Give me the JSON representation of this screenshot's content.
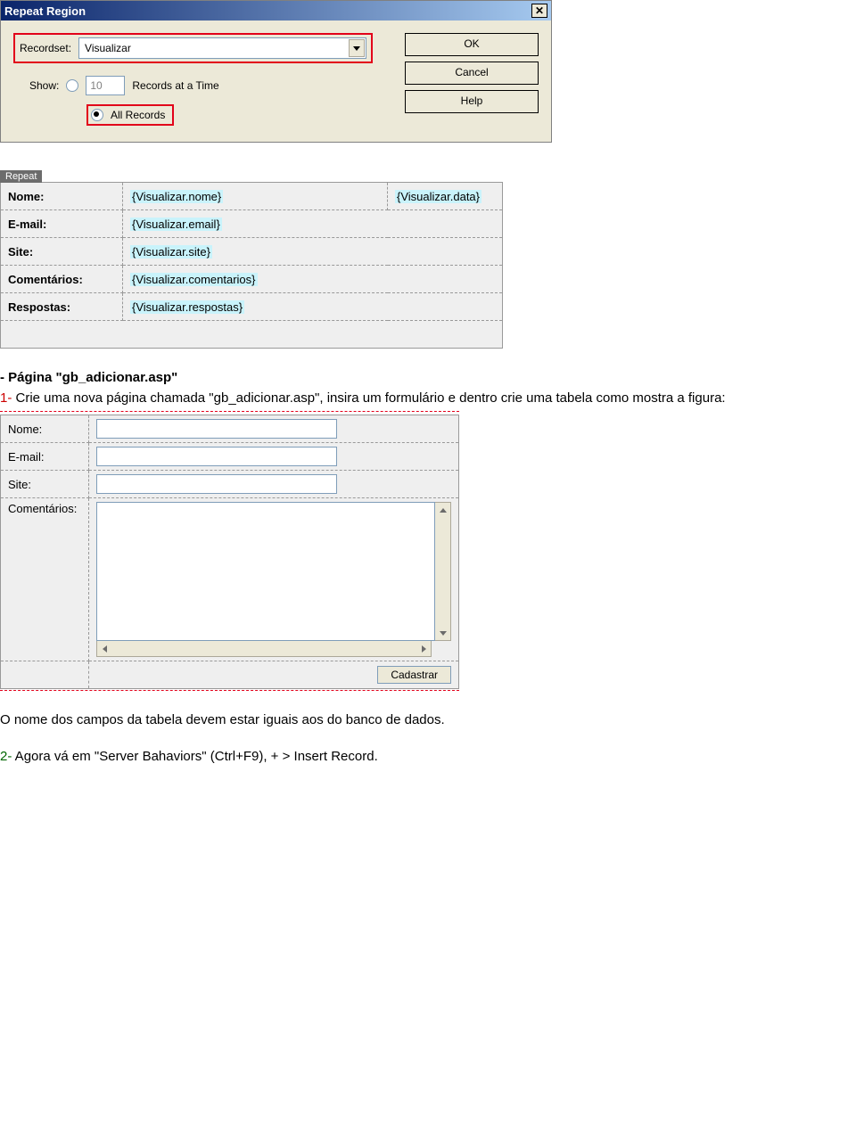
{
  "dialog": {
    "title": "Repeat Region",
    "recordsetLabel": "Recordset:",
    "recordsetValue": "Visualizar",
    "showLabel": "Show:",
    "countValue": "10",
    "recordsAtATime": "Records at a Time",
    "allRecords": "All Records",
    "ok": "OK",
    "cancel": "Cancel",
    "help": "Help"
  },
  "repeatTab": "Repeat",
  "gridA": {
    "rows": [
      {
        "label": "Nome:",
        "value": "Visualizar.nome",
        "extra": "Visualizar.data"
      },
      {
        "label": "E-mail:",
        "value": "Visualizar.email"
      },
      {
        "label": "Site:",
        "value": "Visualizar.site"
      },
      {
        "label": "Comentários:",
        "value": "Visualizar.comentarios"
      },
      {
        "label": "Respostas:",
        "value": "Visualizar.respostas"
      }
    ]
  },
  "section2": {
    "heading": "- Página \"gb_adicionar.asp\"",
    "step1a": "1-",
    "step1b": " Crie uma nova página chamada \"gb_adicionar.asp\", insira um formulário e dentro crie uma tabela como mostra a figura:"
  },
  "gridB": {
    "rows": [
      {
        "label": "Nome:"
      },
      {
        "label": "E-mail:"
      },
      {
        "label": "Site:"
      },
      {
        "label": "Comentários:"
      }
    ],
    "submit": "Cadastrar"
  },
  "footer": {
    "line1": "O nome dos campos da tabela devem estar iguais aos do banco de dados.",
    "step2a": "2-",
    "step2b": " Agora vá em \"Server Bahaviors\" (Ctrl+F9), + > Insert Record."
  }
}
